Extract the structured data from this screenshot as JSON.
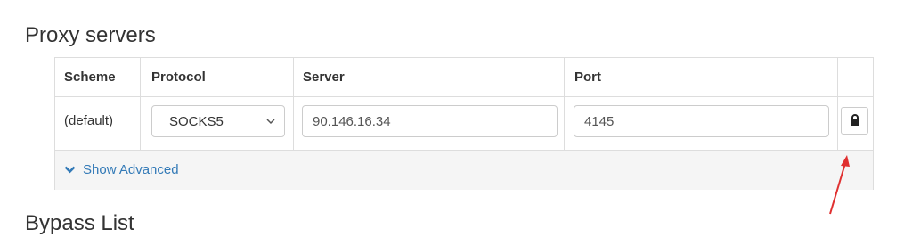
{
  "sections": {
    "proxy_title": "Proxy servers",
    "bypass_title": "Bypass List"
  },
  "table": {
    "headers": {
      "scheme": "Scheme",
      "protocol": "Protocol",
      "server": "Server",
      "port": "Port"
    },
    "row": {
      "scheme": "(default)",
      "protocol": "SOCKS5",
      "server": "90.146.16.34",
      "port": "4145"
    },
    "lock_icon": "lock-icon"
  },
  "advanced": {
    "label": "Show Advanced",
    "icon": "chevron-down-icon"
  },
  "annotation": {
    "color": "#e03030"
  },
  "colors": {
    "link": "#337ab7",
    "border": "#dddddd",
    "footer_bg": "#f5f5f5"
  }
}
